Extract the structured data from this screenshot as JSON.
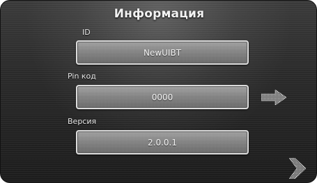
{
  "screen": {
    "title": "Информация"
  },
  "fields": {
    "id": {
      "label": "ID",
      "value": "NewUIBT"
    },
    "pin": {
      "label": "Pin код",
      "value": "0000"
    },
    "version": {
      "label": "Версия",
      "value": "2.0.0.1"
    }
  },
  "icons": {
    "pin_edit": "arrow-right-icon",
    "next_page": "arrow-right-icon"
  },
  "colors": {
    "background": "#2a2a2a",
    "field": "#8a8a8a",
    "field_border": "#dcdcdc",
    "text": "#f2f2f2"
  }
}
